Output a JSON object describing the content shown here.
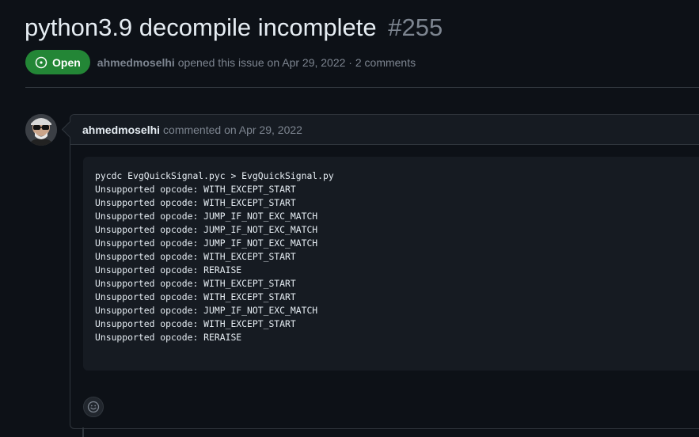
{
  "issue": {
    "title": "python3.9 decompile incomplete",
    "number": "#255",
    "state": "Open",
    "author": "ahmedmoselhi",
    "opened_text": "opened this issue on Apr 29, 2022 · 2 comments"
  },
  "comment": {
    "author": "ahmedmoselhi",
    "when": "commented on Apr 29, 2022",
    "code_lines": [
      "pycdc EvgQuickSignal.pyc > EvgQuickSignal.py",
      "Unsupported opcode: WITH_EXCEPT_START",
      "Unsupported opcode: WITH_EXCEPT_START",
      "Unsupported opcode: JUMP_IF_NOT_EXC_MATCH",
      "Unsupported opcode: JUMP_IF_NOT_EXC_MATCH",
      "Unsupported opcode: JUMP_IF_NOT_EXC_MATCH",
      "Unsupported opcode: WITH_EXCEPT_START",
      "Unsupported opcode: RERAISE",
      "Unsupported opcode: WITH_EXCEPT_START",
      "Unsupported opcode: WITH_EXCEPT_START",
      "Unsupported opcode: JUMP_IF_NOT_EXC_MATCH",
      "Unsupported opcode: WITH_EXCEPT_START",
      "Unsupported opcode: RERAISE"
    ]
  },
  "icons": {
    "state": "issue-opened-icon",
    "copy": "copy-icon",
    "reaction": "smiley-icon"
  },
  "colors": {
    "background": "#0d1117",
    "open_badge": "#238636",
    "muted_text": "#7d8590",
    "border": "#30363d"
  }
}
